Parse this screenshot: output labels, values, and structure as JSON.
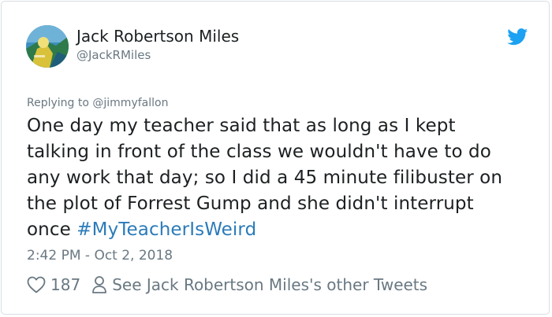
{
  "author": {
    "display_name": "Jack Robertson Miles",
    "handle": "@JackRMiles",
    "avatar_icon": "profile-avatar"
  },
  "brand": {
    "icon": "twitter-bird-icon",
    "color": "#1da1f2"
  },
  "reply": {
    "prefix": "Replying to",
    "to_handle": "@jimmyfallon"
  },
  "tweet": {
    "lines": [
      "One day my teacher said that as long as I kept",
      "talking in front of the class we wouldn't have to do",
      "any work that day; so I did a 45 minute filibuster on",
      "the plot of Forrest Gump and she didn't interrupt"
    ],
    "last_line_text": "once",
    "hashtag": "#MyTeacherIsWeird",
    "hashtag_color": "#2b7bb9"
  },
  "timestamp": "2:42 PM - Oct 2, 2018",
  "actions": {
    "like_icon": "heart-icon",
    "like_count": "187",
    "profile_icon": "person-icon",
    "see_more_label": "See Jack Robertson Miles's other Tweets"
  }
}
